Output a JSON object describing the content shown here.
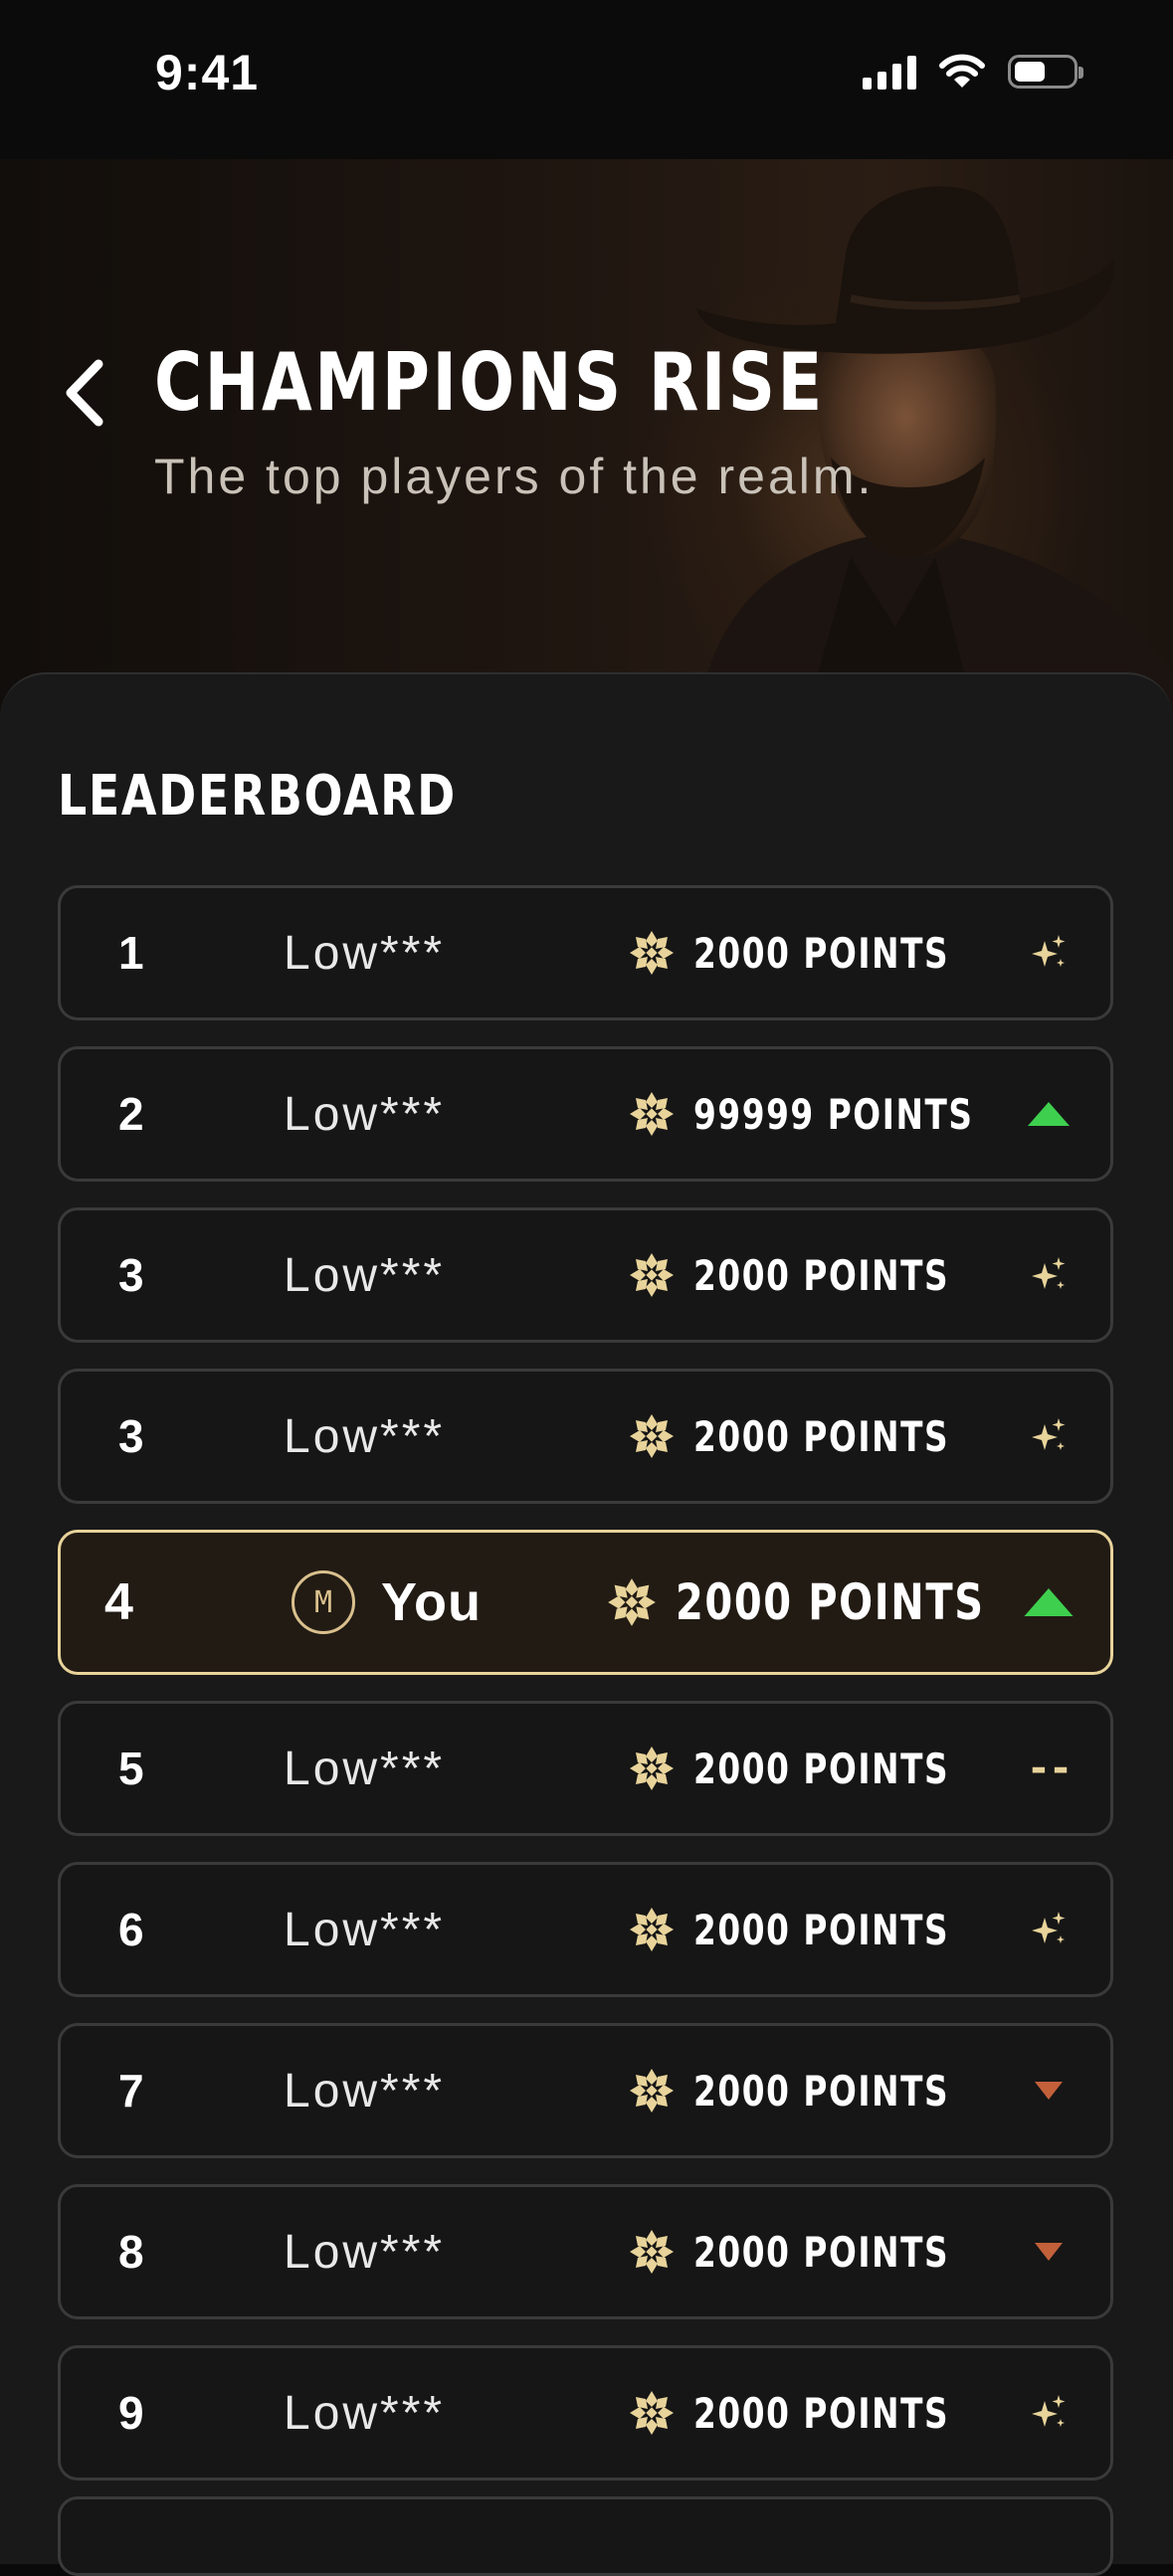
{
  "status": {
    "time": "9:41"
  },
  "hero": {
    "title": "CHAMPIONS RISE",
    "subtitle": "The top players of the realm."
  },
  "leaderboard": {
    "title": "LEADERBOARD",
    "rows": [
      {
        "rank": "1",
        "name": "Low***",
        "points": "2000 POINTS",
        "trend": "sparkle"
      },
      {
        "rank": "2",
        "name": "Low***",
        "points": "99999 POINTS",
        "trend": "up"
      },
      {
        "rank": "3",
        "name": "Low***",
        "points": "2000 POINTS",
        "trend": "sparkle"
      },
      {
        "rank": "3",
        "name": "Low***",
        "points": "2000 POINTS",
        "trend": "sparkle"
      },
      {
        "rank": "4",
        "name": "You",
        "badge": "M",
        "points": "2000 POINTS",
        "trend": "up",
        "is_you": true
      },
      {
        "rank": "5",
        "name": "Low***",
        "points": "2000 POINTS",
        "trend": "same",
        "trend_text": "--"
      },
      {
        "rank": "6",
        "name": "Low***",
        "points": "2000 POINTS",
        "trend": "sparkle"
      },
      {
        "rank": "7",
        "name": "Low***",
        "points": "2000 POINTS",
        "trend": "down"
      },
      {
        "rank": "8",
        "name": "Low***",
        "points": "2000 POINTS",
        "trend": "down"
      },
      {
        "rank": "9",
        "name": "Low***",
        "points": "2000 POINTS",
        "trend": "sparkle"
      }
    ]
  },
  "colors": {
    "accent": "#e8d39a",
    "up": "#3fcf4f",
    "down": "#c2603a",
    "panel": "#191919"
  }
}
